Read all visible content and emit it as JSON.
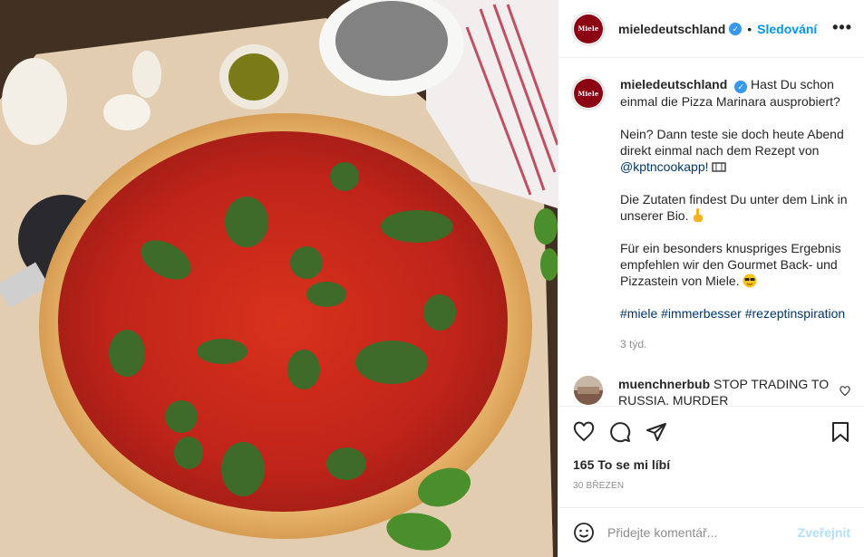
{
  "post": {
    "username": "mieledeutschland",
    "verified_mark": "✓",
    "dot": "•",
    "follow_label": "Sledování",
    "more_label": "•••",
    "avatar_text": "Miele"
  },
  "caption": {
    "username": "mieledeutschland",
    "line1": "Hast Du schon einmal die Pizza Marinara ausprobiert?",
    "para2": "Nein? Dann teste sie doch heute Abend direkt einmal nach dem Rezept von",
    "mention": "@kptncookapp!",
    "para3": "Die Zutaten findest Du unter dem Link in unserer Bio.",
    "para4": "Für ein besonders knuspriges Ergebnis empfehlen wir den Gourmet Back- und Pizzastein von Miele.",
    "hashtags": "#miele #immerbesser #rezeptinspiration",
    "time": "3 týd."
  },
  "comment": {
    "username": "muenchnerbub",
    "text": "STOP TRADING TO RUSSIA. MURDER"
  },
  "actions": {
    "icons": [
      "heart-icon",
      "comment-icon",
      "share-icon",
      "bookmark-icon"
    ],
    "likes": "165 To se mi líbí",
    "date": "30 březen"
  },
  "add_comment": {
    "placeholder": "Přidejte komentář...",
    "post_label": "Zveřejnit"
  },
  "colors": {
    "accent": "#0095f6",
    "brand": "#8c0014",
    "muted": "#8e8e8e"
  }
}
